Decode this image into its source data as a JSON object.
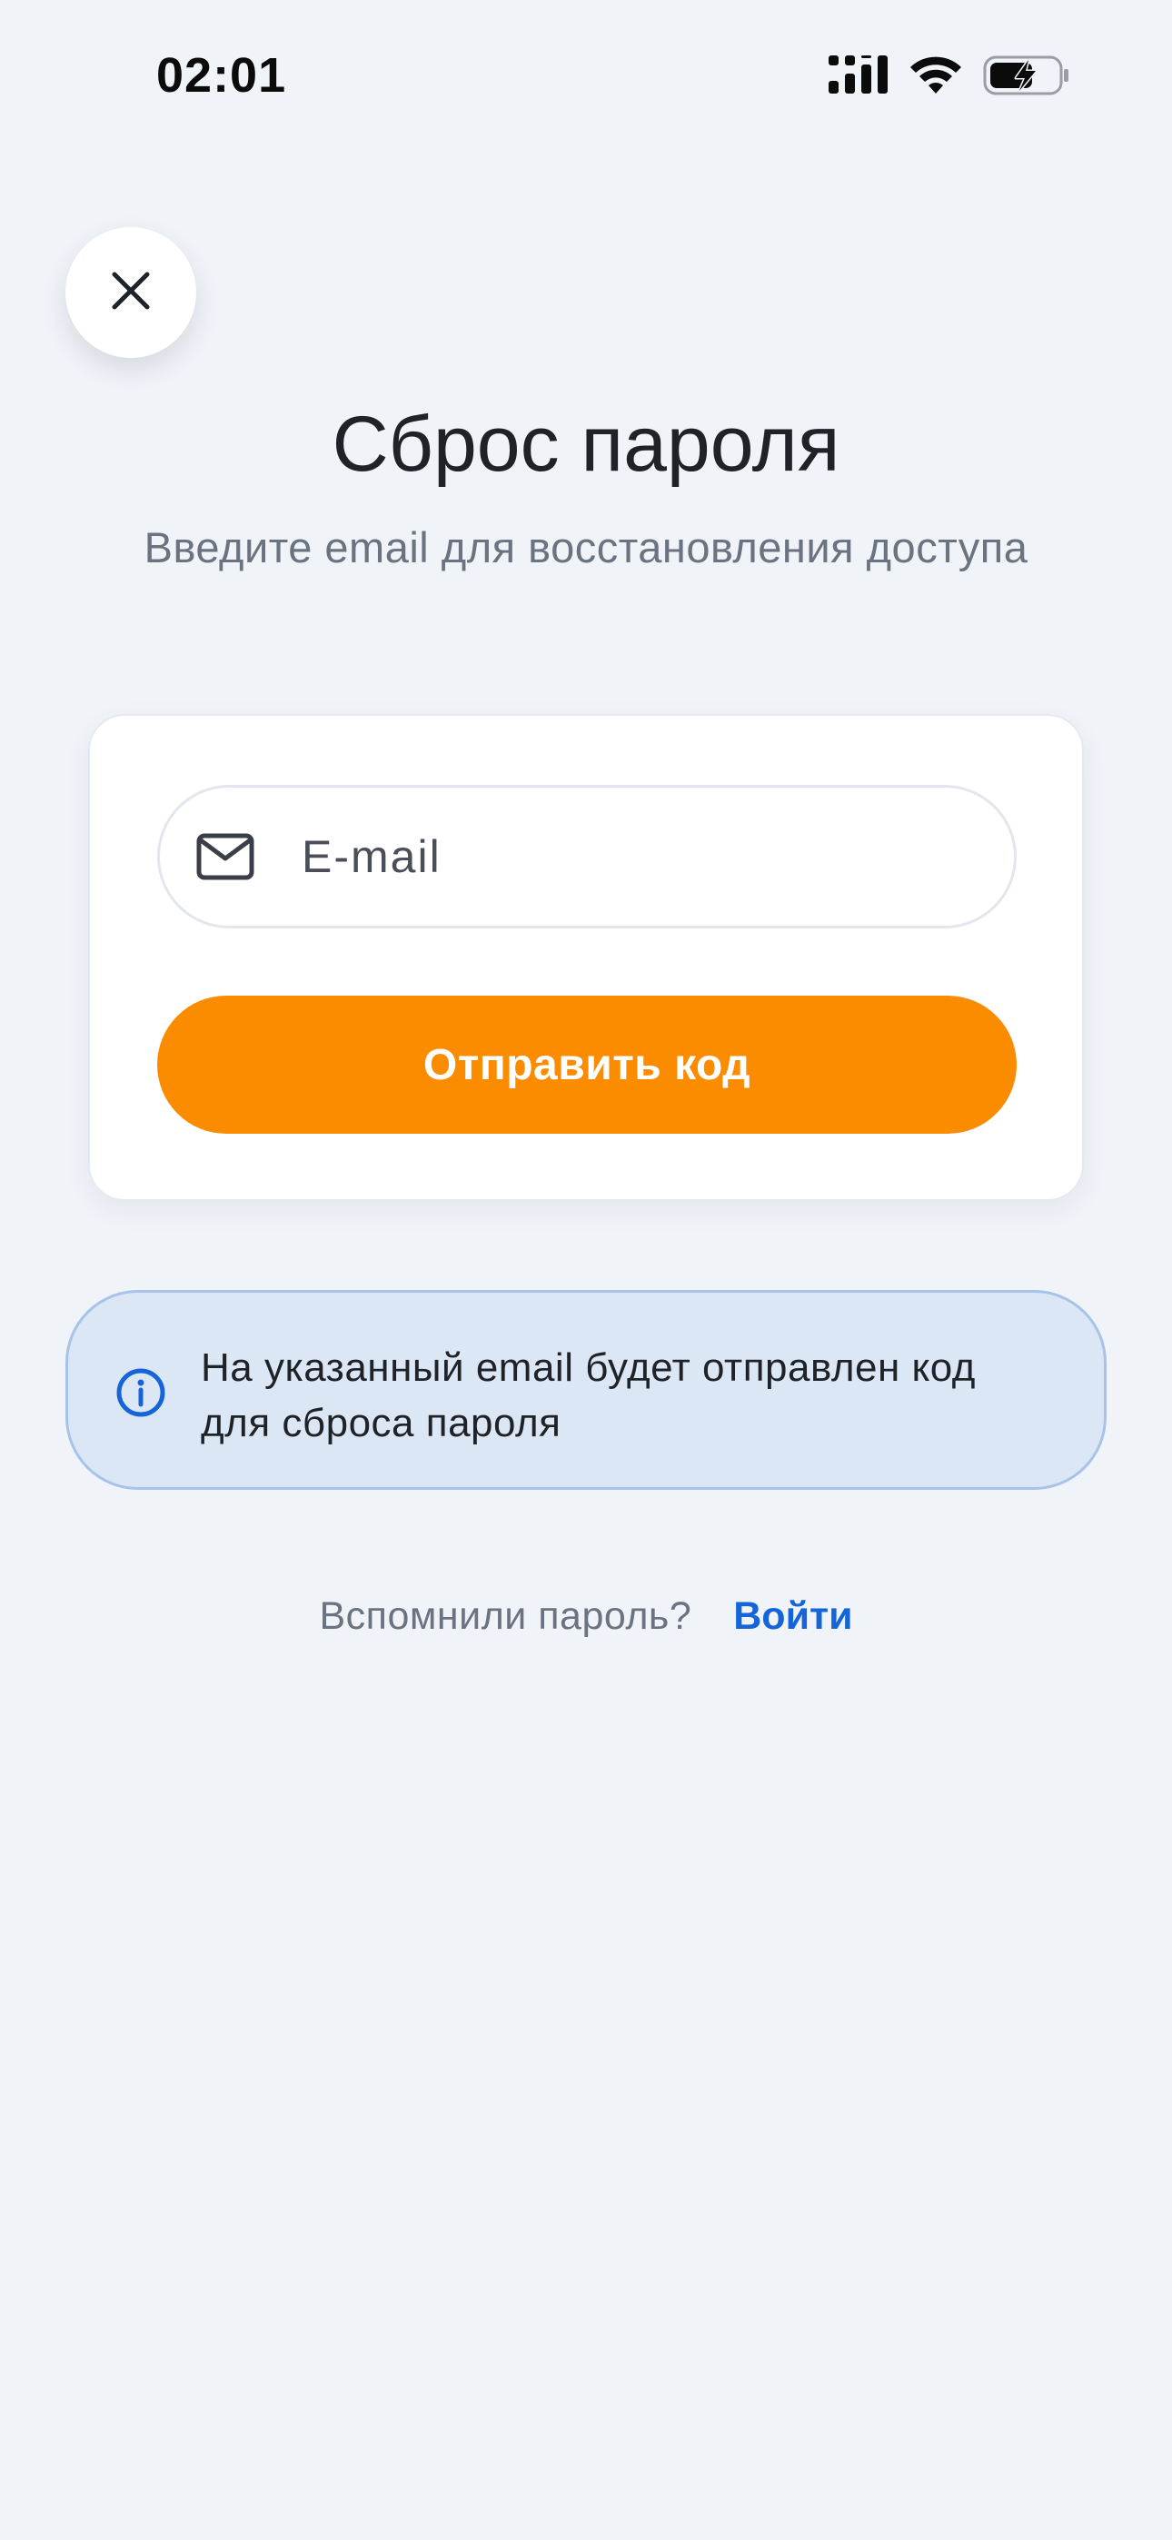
{
  "status_bar": {
    "time": "02:01",
    "icons": [
      "cellular-signal-icon",
      "wifi-icon",
      "battery-charging-icon"
    ]
  },
  "close_button": {
    "icon": "close-icon"
  },
  "header": {
    "title": "Сброс пароля",
    "subtitle": "Введите email для восстановления доступа"
  },
  "form": {
    "email": {
      "icon": "mail-icon",
      "value": "",
      "placeholder": "E-mail"
    },
    "submit_label": "Отправить код"
  },
  "info": {
    "icon": "info-icon",
    "text": "На указанный email будет отправлен код для сброса пароля"
  },
  "footer": {
    "question": "Вспомнили пароль?",
    "link_label": "Войти"
  },
  "colors": {
    "background": "#F0F3F8",
    "accent": "#FB8C00",
    "link": "#1565D8",
    "info_background": "#DCE7F6",
    "info_border": "#A7C3EA"
  }
}
